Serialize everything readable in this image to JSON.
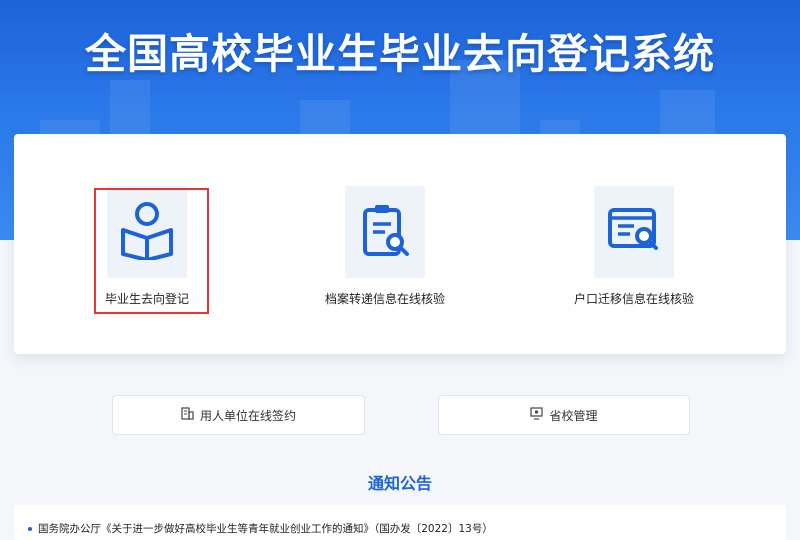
{
  "banner": {
    "title": "全国高校毕业生毕业去向登记系统"
  },
  "services": [
    {
      "label": "毕业生去向登记",
      "icon": "graduate-reading-icon"
    },
    {
      "label": "档案转递信息在线核验",
      "icon": "document-search-icon"
    },
    {
      "label": "户口迁移信息在线核验",
      "icon": "id-card-search-icon"
    }
  ],
  "secondary": [
    {
      "label": "用人单位在线签约",
      "icon": "building-icon"
    },
    {
      "label": "省校管理",
      "icon": "admin-screen-icon"
    }
  ],
  "notices": {
    "title": "通知公告",
    "items": [
      {
        "text": "国务院办公厅《关于进一步做好高校毕业生等青年就业创业工作的通知》（国办发〔2022〕13号）"
      }
    ]
  },
  "colors": {
    "primary": "#1d63d8",
    "highlight": "#e53535",
    "tile_bg": "#eef3f9"
  }
}
